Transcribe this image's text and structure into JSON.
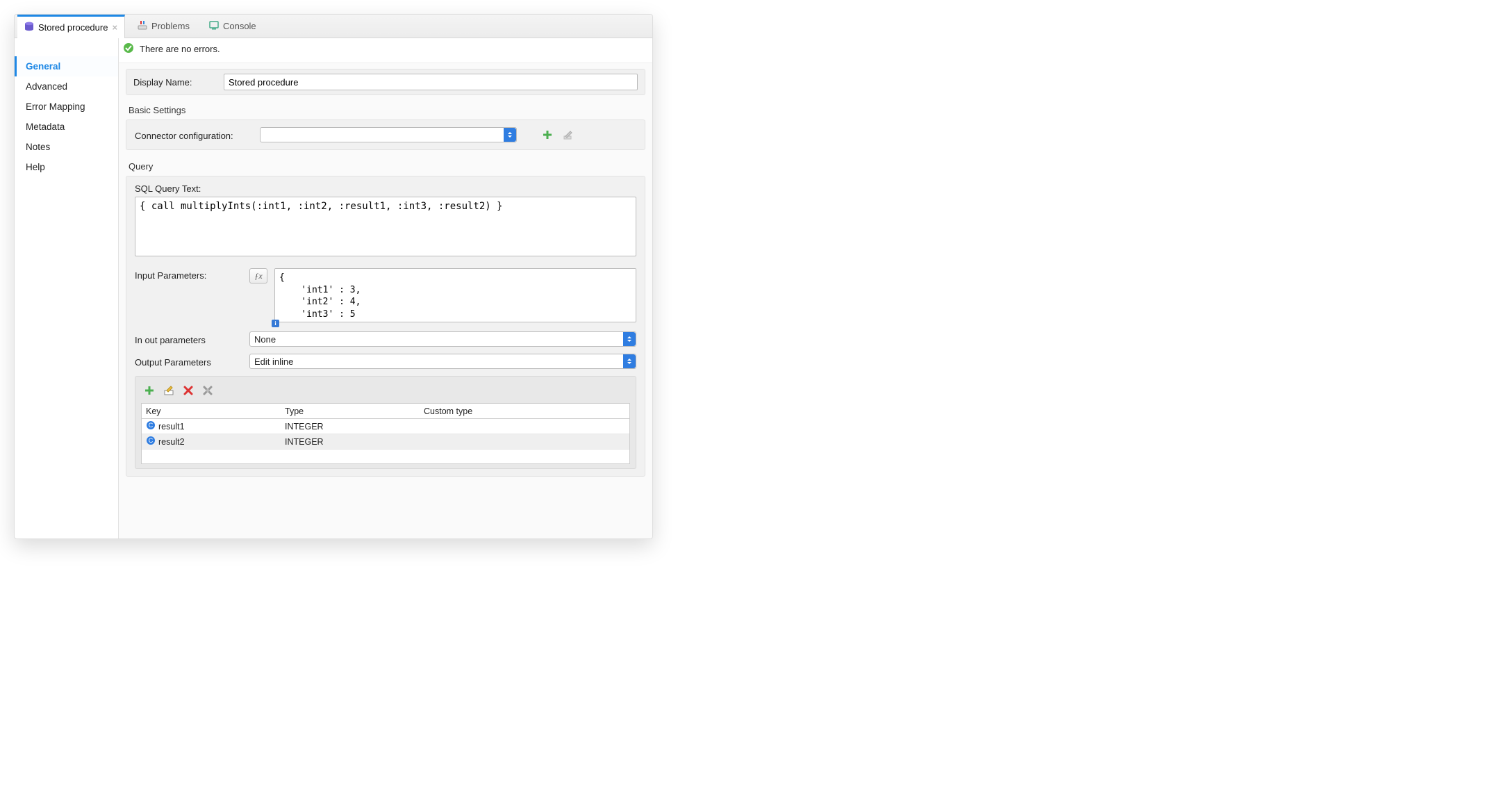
{
  "tabs": {
    "active": {
      "label": "Stored procedure"
    },
    "problems": {
      "label": "Problems"
    },
    "console": {
      "label": "Console"
    }
  },
  "sidebar": {
    "items": [
      "General",
      "Advanced",
      "Error Mapping",
      "Metadata",
      "Notes",
      "Help"
    ],
    "activeIndex": 0
  },
  "status": {
    "text": "There are no errors."
  },
  "displayName": {
    "label": "Display Name:",
    "value": "Stored procedure"
  },
  "basicSettings": {
    "title": "Basic Settings",
    "connector": {
      "label": "Connector configuration:",
      "value": ""
    }
  },
  "query": {
    "title": "Query",
    "sqlLabel": "SQL Query Text:",
    "sqlText": "{ call multiplyInts(:int1, :int2, :result1, :int3, :result2) }",
    "inputParamsLabel": "Input Parameters:",
    "inputParamsValue": "{\n    'int1' : 3,\n    'int2' : 4,\n    'int3' : 5\n}",
    "inOutLabel": "In out parameters",
    "inOutValue": "None",
    "outputLabel": "Output Parameters",
    "outputValue": "Edit inline"
  },
  "outputTable": {
    "headers": {
      "key": "Key",
      "type": "Type",
      "custom": "Custom type"
    },
    "rows": [
      {
        "key": "result1",
        "type": "INTEGER",
        "custom": ""
      },
      {
        "key": "result2",
        "type": "INTEGER",
        "custom": ""
      }
    ]
  }
}
